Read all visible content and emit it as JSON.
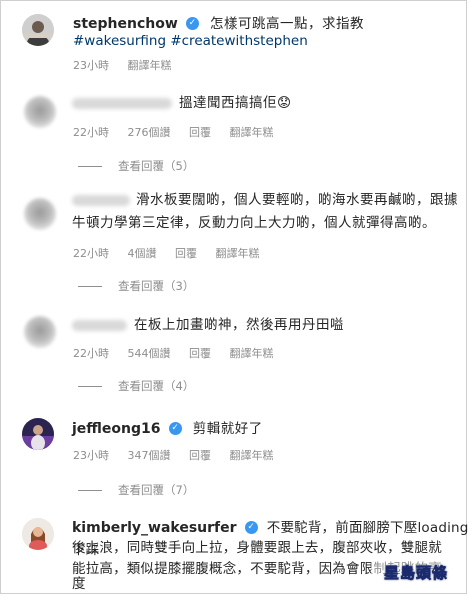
{
  "post": {
    "username": "stephenchow",
    "caption": "怎樣可跳高一點，求指教",
    "hashtags": "#wakesurfing #createwithstephen",
    "time": "23小時",
    "translate": "翻譯年糕"
  },
  "comments": [
    {
      "text": "搵達聞西搞搞佢😟",
      "time": "22小時",
      "likes": "276個讚",
      "reply": "回覆",
      "translate": "翻譯年糕",
      "view_replies": "查看回覆（5）"
    },
    {
      "text_line1": "滑水板要闊啲，個人要輕啲，啲海水要再鹹啲，跟據",
      "text_line2": "牛頓力學第三定律，反動力向上大力啲，個人就彈得高啲。",
      "time": "22小時",
      "likes": "4個讚",
      "reply": "回覆",
      "translate": "翻譯年糕",
      "view_replies": "查看回覆（3）"
    },
    {
      "text": "在板上加畫啲神，然後再用丹田嗌",
      "time": "22小時",
      "likes": "544個讚",
      "reply": "回覆",
      "translate": "翻譯年糕",
      "view_replies": "查看回覆（4）"
    },
    {
      "username": "jeffleong16",
      "text": "剪輯就好了",
      "time": "23小時",
      "likes": "347個讚",
      "reply": "回覆",
      "translate": "翻譯年糕",
      "view_replies": "查看回覆（7）"
    },
    {
      "username": "kimberly_wakesurfer",
      "text_line1": "不要駝背，前面腳膀下壓loading下踩",
      "text_line2": "後上浪，同時雙手向上拉，身體要跟上去，腹部夾收，雙腿就",
      "text_line3": "能拉高，類似提膝擺腹概念，不要駝背，因為會限制起跳的高",
      "text_line4": "度"
    }
  ],
  "watermark": "星島頭條"
}
